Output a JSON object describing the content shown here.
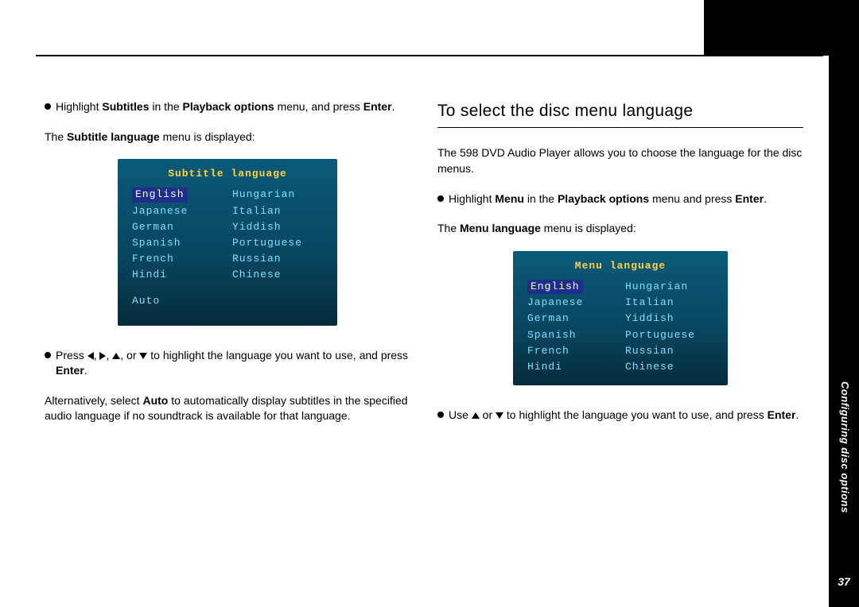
{
  "sidebar": {
    "label": "Configuring disc options",
    "page_number": "37"
  },
  "left": {
    "bullet1_pre": "Highlight ",
    "bullet1_b1": "Subtitles",
    "bullet1_mid": " in the ",
    "bullet1_b2": "Playback options",
    "bullet1_after": " menu, and press ",
    "bullet1_enter": "Enter",
    "bullet1_end": ".",
    "p2_pre": "The ",
    "p2_b": "Subtitle language",
    "p2_after": " menu is displayed:",
    "osd_title": "Subtitle language",
    "osd_left": [
      "English",
      "Japanese",
      "German",
      "Spanish",
      "French",
      "Hindi"
    ],
    "osd_right": [
      "Hungarian",
      "Italian",
      "Yiddish",
      "Portuguese",
      "Russian",
      "Chinese"
    ],
    "osd_extra": "Auto",
    "bullet3_pre": "Press ",
    "bullet3_mid": " to highlight the language you want to use, and press ",
    "bullet3_enter": "Enter",
    "bullet3_end": ".",
    "p4_pre": "Alternatively, select ",
    "p4_b": "Auto",
    "p4_after": " to automatically display subtitles in the specified audio language if no soundtrack is available for that language."
  },
  "right": {
    "heading": "To select the disc menu language",
    "p1": "The 598 DVD Audio Player allows you to choose the language for the disc menus.",
    "bullet2_pre": "Highlight ",
    "bullet2_b1": "Menu",
    "bullet2_mid": " in the ",
    "bullet2_b2": "Playback options",
    "bullet2_after": " menu and press ",
    "bullet2_enter": "Enter",
    "bullet2_end": ".",
    "p3_pre": "The ",
    "p3_b": "Menu language",
    "p3_after": " menu is displayed:",
    "osd_title": "Menu language",
    "osd_left": [
      "English",
      "Japanese",
      "German",
      "Spanish",
      "French",
      "Hindi"
    ],
    "osd_right": [
      "Hungarian",
      "Italian",
      "Yiddish",
      "Portuguese",
      "Russian",
      "Chinese"
    ],
    "bullet4_pre": "Use ",
    "bullet4_mid": " to highlight the language you want to use, and press ",
    "bullet4_enter": "Enter",
    "bullet4_end": "."
  }
}
